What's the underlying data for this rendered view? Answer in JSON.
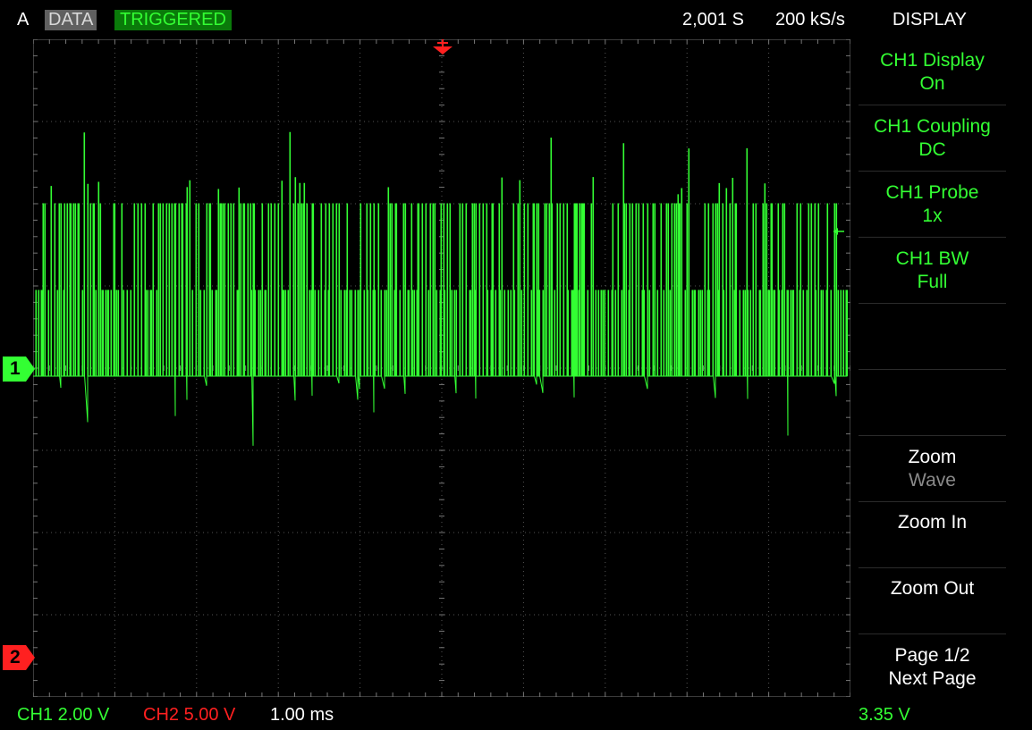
{
  "topbar": {
    "label_a": "A",
    "data_badge": "DATA",
    "trigger_status": "TRIGGERED",
    "samples": "2,001 S",
    "sample_rate": "200 kS/s",
    "menu_title": "DISPLAY"
  },
  "menu": {
    "items": [
      {
        "line1": "CH1 Display",
        "line2": "On"
      },
      {
        "line1": "CH1 Coupling",
        "line2": "DC"
      },
      {
        "line1": "CH1 Probe",
        "line2": "1x"
      },
      {
        "line1": "CH1 BW",
        "line2": "Full"
      },
      {
        "line1": "",
        "line2": ""
      },
      {
        "line1": "",
        "line2": ""
      },
      {
        "line1": "Zoom",
        "line2": "Wave"
      },
      {
        "line1": "Zoom In",
        "line2": ""
      },
      {
        "line1": "Zoom Out",
        "line2": ""
      },
      {
        "line1": "Page 1/2",
        "line2": "Next Page"
      }
    ]
  },
  "bottombar": {
    "ch1_scale": "CH1 2.00 V",
    "ch2_scale": "CH2 5.00 V",
    "timebase": "1.00 ms",
    "trigger_level": "3.35 V"
  },
  "markers": {
    "ch1": "1",
    "ch2": "2"
  },
  "colors": {
    "ch1": "#33ff33",
    "ch2": "#ff2020",
    "trigger_badge_bg": "#0a7a0a",
    "data_badge_bg": "#606060",
    "grid": "#555555"
  }
}
